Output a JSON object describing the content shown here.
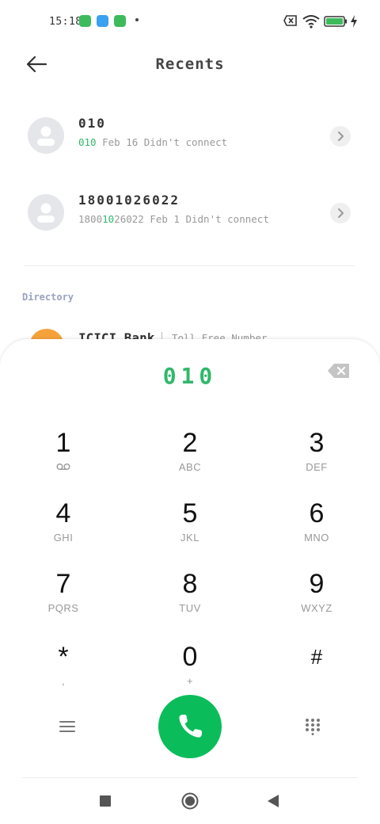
{
  "status_bar": {
    "time": "15:18"
  },
  "header": {
    "title": "Recents"
  },
  "recents": [
    {
      "name": "010",
      "sub_match": "010",
      "sub_rest": " Feb 16 Didn't connect",
      "sub_prefix": ""
    },
    {
      "name": "18001026022",
      "sub_prefix": "1800",
      "sub_match": "10",
      "sub_rest": "26022 Feb 1 Didn't connect"
    }
  ],
  "directory": {
    "label": "Directory",
    "item": {
      "name": "ICICI Bank",
      "tag": "Toll Free Number"
    }
  },
  "dialer": {
    "dialed_number": "010",
    "keys": [
      {
        "digit": "1",
        "letters": ""
      },
      {
        "digit": "2",
        "letters": "ABC"
      },
      {
        "digit": "3",
        "letters": "DEF"
      },
      {
        "digit": "4",
        "letters": "GHI"
      },
      {
        "digit": "5",
        "letters": "JKL"
      },
      {
        "digit": "6",
        "letters": "MNO"
      },
      {
        "digit": "7",
        "letters": "PQRS"
      },
      {
        "digit": "8",
        "letters": "TUV"
      },
      {
        "digit": "9",
        "letters": "WXYZ"
      },
      {
        "digit": "*",
        "letters": ","
      },
      {
        "digit": "0",
        "letters": "+"
      },
      {
        "digit": "#",
        "letters": ""
      }
    ]
  },
  "icons": {
    "back": "arrow-left-icon",
    "backspace": "backspace-icon",
    "call": "phone-icon",
    "menu": "menu-icon",
    "dialpad": "dialpad-icon",
    "voicemail": "voicemail-icon"
  },
  "colors": {
    "accent_green": "#2fb86a",
    "call_button": "#0bbd5a",
    "directory_avatar": "#f5a23b"
  }
}
